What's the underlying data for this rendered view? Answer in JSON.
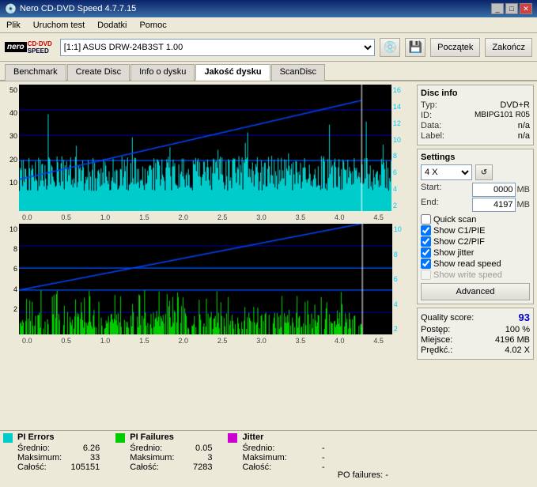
{
  "titleBar": {
    "title": "Nero CD-DVD Speed 4.7.7.15",
    "buttons": [
      "_",
      "□",
      "✕"
    ]
  },
  "menuBar": {
    "items": [
      "Plik",
      "Uruchom test",
      "Dodatki",
      "Pomoc"
    ]
  },
  "toolbar": {
    "driveLabel": "[1:1]  ASUS DRW-24B3ST 1.00",
    "startBtn": "Początek",
    "endBtn": "Zakończ"
  },
  "tabs": [
    {
      "label": "Benchmark",
      "active": false
    },
    {
      "label": "Create Disc",
      "active": false
    },
    {
      "label": "Info o dysku",
      "active": false
    },
    {
      "label": "Jakość dysku",
      "active": true
    },
    {
      "label": "ScanDisc",
      "active": false
    }
  ],
  "discInfo": {
    "title": "Disc info",
    "typ": {
      "label": "Typ:",
      "value": "DVD+R"
    },
    "id": {
      "label": "ID:",
      "value": "MBIPG101 R05"
    },
    "data": {
      "label": "Data:",
      "value": "n/a"
    },
    "label": {
      "label": "Label:",
      "value": "n/a"
    }
  },
  "settings": {
    "title": "Settings",
    "speed": "4 X",
    "start": {
      "label": "Start:",
      "value": "0000",
      "unit": "MB"
    },
    "end": {
      "label": "End:",
      "value": "4197",
      "unit": "MB"
    },
    "checkboxes": [
      {
        "label": "Quick scan",
        "checked": false,
        "enabled": true
      },
      {
        "label": "Show C1/PIE",
        "checked": true,
        "enabled": true
      },
      {
        "label": "Show C2/PIF",
        "checked": true,
        "enabled": true
      },
      {
        "label": "Show jitter",
        "checked": true,
        "enabled": true
      },
      {
        "label": "Show read speed",
        "checked": true,
        "enabled": true
      },
      {
        "label": "Show write speed",
        "checked": false,
        "enabled": false
      }
    ],
    "advancedBtn": "Advanced"
  },
  "qualityScore": {
    "label": "Quality score:",
    "value": "93"
  },
  "progress": {
    "postep": {
      "label": "Postęp:",
      "value": "100 %"
    },
    "miejsce": {
      "label": "Miejsce:",
      "value": "4196 MB"
    },
    "predkosc": {
      "label": "Prędkć.:",
      "value": "4.02 X"
    }
  },
  "stats": {
    "piErrors": {
      "title": "PI Errors",
      "color": "#00cccc",
      "rows": [
        {
          "label": "Średnio:",
          "value": "6.26"
        },
        {
          "label": "Maksimum:",
          "value": "33"
        },
        {
          "label": "Całość:",
          "value": "105151"
        }
      ]
    },
    "piFailures": {
      "title": "PI Failures",
      "color": "#00cc00",
      "rows": [
        {
          "label": "Średnio:",
          "value": "0.05"
        },
        {
          "label": "Maksimum:",
          "value": "3"
        },
        {
          "label": "Całość:",
          "value": "7283"
        }
      ]
    },
    "jitter": {
      "title": "Jitter",
      "color": "#cc00cc",
      "rows": [
        {
          "label": "Średnio:",
          "value": "-"
        },
        {
          "label": "Maksimum:",
          "value": "-"
        },
        {
          "label": "Całość:",
          "value": "-"
        }
      ]
    },
    "poFailures": "PO failures:        -"
  },
  "topChart": {
    "yMax": 50,
    "yLabelsLeft": [
      50,
      40,
      30,
      20,
      10
    ],
    "yLabelsRight": [
      16,
      14,
      12,
      10,
      8,
      6,
      4,
      2
    ],
    "xLabels": [
      "0.0",
      "0.5",
      "1.0",
      "1.5",
      "2.0",
      "2.5",
      "3.0",
      "3.5",
      "4.0",
      "4.5"
    ]
  },
  "bottomChart": {
    "yMax": 10,
    "yLabelsLeft": [
      10,
      8,
      6,
      4,
      2
    ],
    "yLabelsRight": [
      10,
      8,
      6,
      4,
      2
    ],
    "xLabels": [
      "0.0",
      "0.5",
      "1.0",
      "1.5",
      "2.0",
      "2.5",
      "3.0",
      "3.5",
      "4.0",
      "4.5"
    ]
  }
}
